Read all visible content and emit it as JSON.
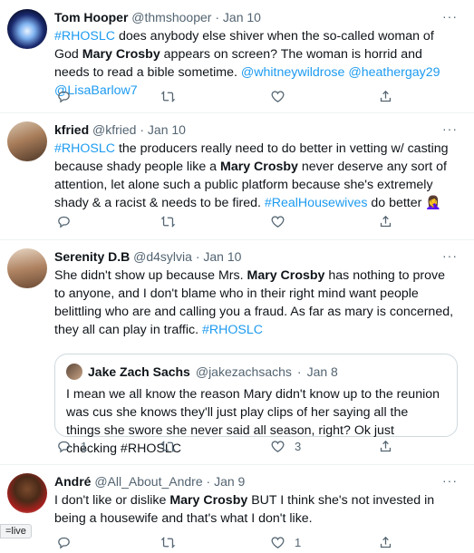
{
  "tweets": [
    {
      "name": "Tom Hooper",
      "handle": "@thmshooper",
      "sep": "·",
      "date": "Jan 10",
      "t1": "#RHOSLC",
      "t2": " does anybody else shiver when the so-called woman of God ",
      "t3": "Mary Crosby",
      "t4": " appears on screen? The woman is horrid and needs to read a bible sometime. ",
      "t5": "@whitneywildrose @heathergay29 @LisaBarlow7",
      "more": "···"
    },
    {
      "name": "kfried",
      "handle": "@kfried",
      "sep": "·",
      "date": "Jan 10",
      "t1": "#RHOSLC",
      "t2": " the producers really need to do better in vetting w/ casting because shady people like a ",
      "t3": "Mary Crosby",
      "t4": " never deserve any sort of attention, let alone such a public platform because she's extremely shady & a racist & needs to be fired. ",
      "t5": "#RealHousewives",
      "t6": " do better 🤦‍♀️",
      "more": "···"
    },
    {
      "name": "Serenity D.B",
      "handle": "@d4sylvia",
      "sep": "·",
      "date": "Jan 10",
      "t1": "She didn't show up because Mrs. ",
      "t2": "Mary Crosby",
      "t3": " has nothing to prove to anyone, and I don't blame who in their right mind want people belittling who are and calling you a fraud. As far as mary is concerned, they all can play in traffic. ",
      "t4": "#RHOSLC",
      "more": "···",
      "quote": {
        "name": "Jake Zach Sachs",
        "handle": "@jakezachsachs",
        "sep": "·",
        "date": "Jan 8",
        "text": "I mean we all know the reason Mary didn't know up to the reunion was cus she knows they'll just play clips of her saying all the things she swore she never said all season, right? Ok just checking #RHOSLC"
      },
      "reply_count": "1",
      "like_count": "3"
    },
    {
      "name": "André",
      "handle": "@All_About_Andre",
      "sep": "·",
      "date": "Jan 9",
      "t1": "I don't like or dislike ",
      "t2": "Mary Crosby",
      "t3": " BUT I think she's not invested in being a housewife and that's what I don't like.",
      "more": "···",
      "like_count": "1"
    }
  ],
  "status_bar": "=live",
  "icons": [
    "reply-icon",
    "retweet-icon",
    "like-icon",
    "share-icon"
  ],
  "colors": {
    "link": "#1d9bf0",
    "meta": "#536471",
    "border": "#eff3f4"
  }
}
